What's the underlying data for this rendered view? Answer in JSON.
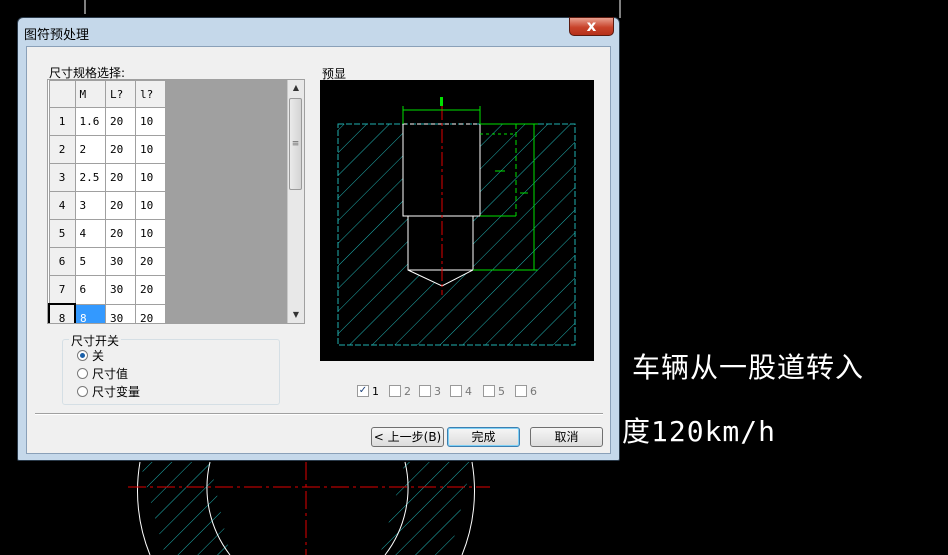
{
  "dialog": {
    "title": "图符预处理",
    "close_symbol": "x"
  },
  "size_spec": {
    "label": "尺寸规格选择:",
    "columns": [
      "M",
      "L?",
      "l?"
    ],
    "rows": [
      {
        "index": "1",
        "cells": [
          "1.6",
          "20",
          "10"
        ]
      },
      {
        "index": "2",
        "cells": [
          "2",
          "20",
          "10"
        ]
      },
      {
        "index": "3",
        "cells": [
          "2.5",
          "20",
          "10"
        ]
      },
      {
        "index": "4",
        "cells": [
          "3",
          "20",
          "10"
        ]
      },
      {
        "index": "5",
        "cells": [
          "4",
          "20",
          "10"
        ]
      },
      {
        "index": "6",
        "cells": [
          "5",
          "30",
          "20"
        ]
      },
      {
        "index": "7",
        "cells": [
          "6",
          "30",
          "20"
        ]
      },
      {
        "index": "8",
        "cells": [
          "8",
          "30",
          "20"
        ]
      }
    ],
    "selected_row": "8"
  },
  "preview": {
    "label": "预显"
  },
  "dimension_switch": {
    "title": "尺寸开关",
    "options": [
      {
        "label": "关",
        "selected": true
      },
      {
        "label": "尺寸值",
        "selected": false
      },
      {
        "label": "尺寸变量",
        "selected": false
      }
    ]
  },
  "view_checkboxes": [
    {
      "label": "1",
      "checked": true
    },
    {
      "label": "2",
      "checked": false
    },
    {
      "label": "3",
      "checked": false
    },
    {
      "label": "4",
      "checked": false
    },
    {
      "label": "5",
      "checked": false
    },
    {
      "label": "6",
      "checked": false
    }
  ],
  "buttons": {
    "prev": "< 上一步(B)",
    "finish": "完成",
    "cancel": "取消"
  },
  "background_text": {
    "line1": "车辆从一股道转入",
    "line2": "度120km/h"
  },
  "colors": {
    "hatch": "#20b0b0",
    "dimension": "#00e000",
    "centerline": "#e00000",
    "accent": "#3399ff"
  }
}
